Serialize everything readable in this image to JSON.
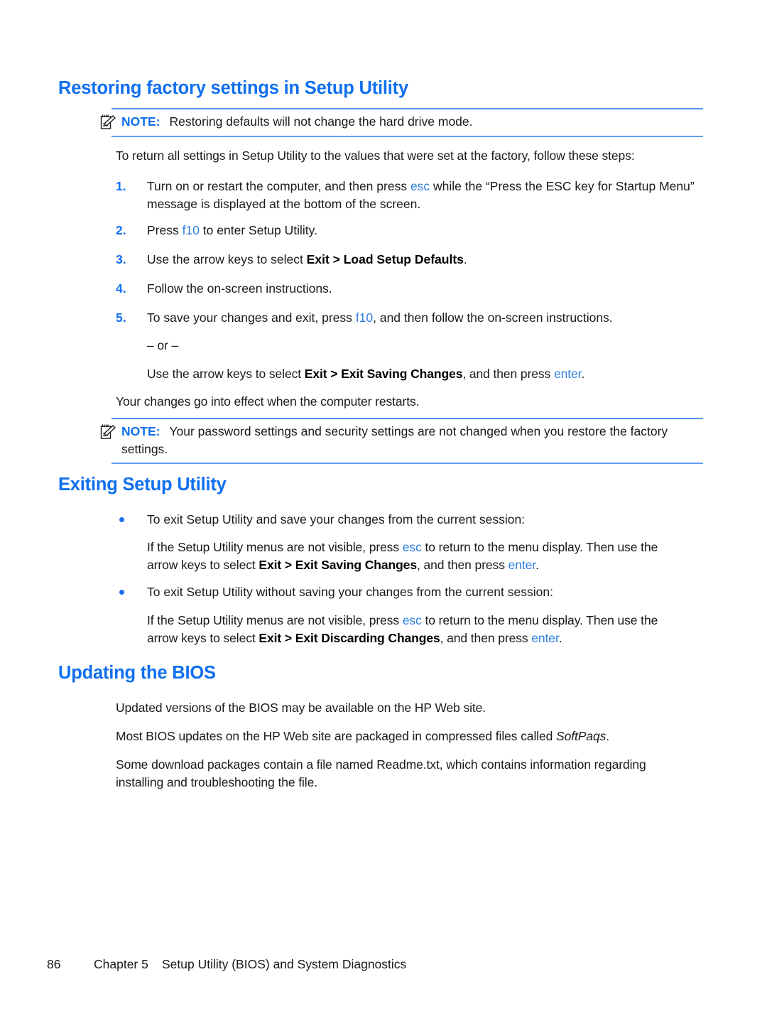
{
  "page": {
    "number": "86",
    "chapter": "Chapter 5",
    "chapter_title": "Setup Utility (BIOS) and System Diagnostics"
  },
  "colors": {
    "heading_blue": "#0f6ff0",
    "key_blue": "#2f7fe0",
    "rule_blue": "#4b92f0",
    "bullet_blue": "#1b6ef0",
    "body_black": "#1a1a1a"
  },
  "sections": {
    "restoring": {
      "title": "Restoring factory settings in Setup Utility",
      "note1": {
        "label": "NOTE:",
        "icon": "note-pencil-icon",
        "text": "Restoring defaults will not change the hard drive mode."
      },
      "intro": "To return all settings in Setup Utility to the values that were set at the factory, follow these steps:",
      "steps": [
        {
          "number": "1.",
          "parts": [
            {
              "t": "Turn on or restart the computer, and then press ",
              "s": "plain"
            },
            {
              "t": "esc",
              "s": "key"
            },
            {
              "t": " while the “Press the ESC key for Startup Menu” message is displayed at the bottom of the screen.",
              "s": "plain"
            }
          ]
        },
        {
          "number": "2.",
          "parts": [
            {
              "t": "Press ",
              "s": "plain"
            },
            {
              "t": "f10",
              "s": "key"
            },
            {
              "t": " to enter Setup Utility.",
              "s": "plain"
            }
          ]
        },
        {
          "number": "3.",
          "parts": [
            {
              "t": "Use the arrow keys to select ",
              "s": "plain"
            },
            {
              "t": "Exit > Load Setup Defaults",
              "s": "bold"
            },
            {
              "t": ".",
              "s": "plain"
            }
          ]
        },
        {
          "number": "4.",
          "parts": [
            {
              "t": "Follow the on-screen instructions.",
              "s": "plain"
            }
          ]
        },
        {
          "number": "5.",
          "parts": [
            {
              "t": "To save your changes and exit, press ",
              "s": "plain"
            },
            {
              "t": "f10",
              "s": "key"
            },
            {
              "t": ", and then follow the on-screen instructions.",
              "s": "plain"
            }
          ]
        }
      ],
      "or_text": "– or –",
      "alt_parts": [
        {
          "t": "Use the arrow keys to select ",
          "s": "plain"
        },
        {
          "t": "Exit > Exit Saving Changes",
          "s": "bold"
        },
        {
          "t": ", and then press ",
          "s": "plain"
        },
        {
          "t": "enter",
          "s": "key"
        },
        {
          "t": ".",
          "s": "plain"
        }
      ],
      "closing": "Your changes go into effect when the computer restarts.",
      "note2": {
        "label": "NOTE:",
        "icon": "note-pencil-icon",
        "text": "Your password settings and security settings are not changed when you restore the factory settings."
      }
    },
    "exiting": {
      "title": "Exiting Setup Utility",
      "bullets": [
        {
          "lead": "To exit Setup Utility and save your changes from the current session:",
          "detail_parts": [
            {
              "t": "If the Setup Utility menus are not visible, press ",
              "s": "plain"
            },
            {
              "t": "esc",
              "s": "key"
            },
            {
              "t": " to return to the menu display. Then use the arrow keys to select ",
              "s": "plain"
            },
            {
              "t": "Exit > Exit Saving Changes",
              "s": "bold"
            },
            {
              "t": ", and then press ",
              "s": "plain"
            },
            {
              "t": "enter",
              "s": "key"
            },
            {
              "t": ".",
              "s": "plain"
            }
          ]
        },
        {
          "lead": "To exit Setup Utility without saving your changes from the current session:",
          "detail_parts": [
            {
              "t": "If the Setup Utility menus are not visible, press ",
              "s": "plain"
            },
            {
              "t": "esc",
              "s": "key"
            },
            {
              "t": " to return to the menu display. Then use the arrow keys to select ",
              "s": "plain"
            },
            {
              "t": "Exit > Exit Discarding Changes",
              "s": "bold"
            },
            {
              "t": ", and then press ",
              "s": "plain"
            },
            {
              "t": "enter",
              "s": "key"
            },
            {
              "t": ".",
              "s": "plain"
            }
          ]
        }
      ]
    },
    "bios": {
      "title": "Updating the BIOS",
      "paragraphs": [
        [
          {
            "t": "Updated versions of the BIOS may be available on the HP Web site.",
            "s": "plain"
          }
        ],
        [
          {
            "t": "Most BIOS updates on the HP Web site are packaged in compressed files called ",
            "s": "plain"
          },
          {
            "t": "SoftPaqs",
            "s": "italic"
          },
          {
            "t": ".",
            "s": "plain"
          }
        ],
        [
          {
            "t": "Some download packages contain a file named Readme.txt, which contains information regarding installing and troubleshooting the file.",
            "s": "plain"
          }
        ]
      ]
    }
  }
}
